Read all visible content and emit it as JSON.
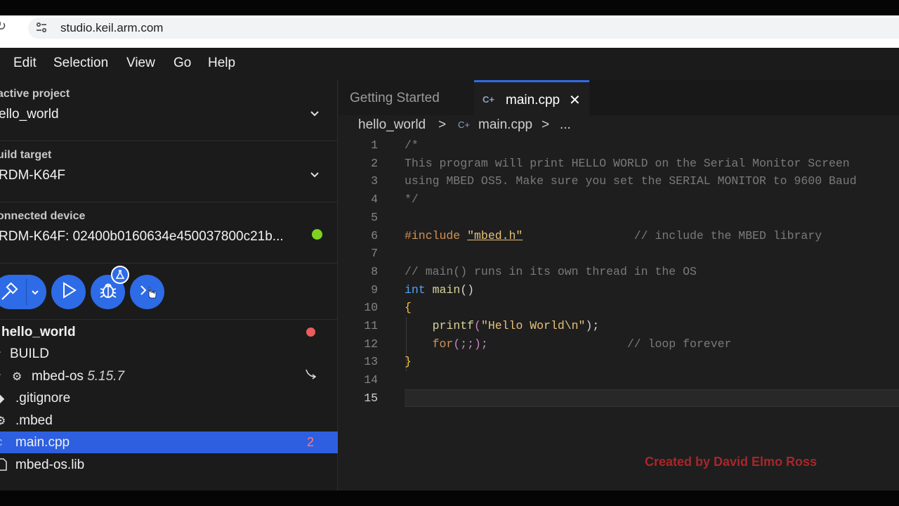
{
  "browser": {
    "url": "studio.keil.arm.com"
  },
  "menu": [
    "Edit",
    "Selection",
    "View",
    "Go",
    "Help"
  ],
  "sidebar": {
    "active_project": {
      "label": "active project",
      "value": "ello_world"
    },
    "build_target": {
      "label": "uild target",
      "value": "RDM-K64F"
    },
    "connected_device": {
      "label": "onnected device",
      "value": "RDM-K64F: 02400b0160634e450037800c21b...",
      "status_color": "#7ed321"
    },
    "actions": [
      "build",
      "run",
      "debug",
      "serial-monitor"
    ],
    "tree": [
      {
        "label": "hello_world",
        "icon": "",
        "badge": "red-dot"
      },
      {
        "label": "BUILD",
        "icon": "chevron-right-icon"
      },
      {
        "label": "mbed-os",
        "version": "5.15.7",
        "icon": "gear-icon",
        "extra": "link-arrow-icon"
      },
      {
        "label": ".gitignore",
        "icon": "git-icon"
      },
      {
        "label": ".mbed",
        "icon": "gear-icon"
      },
      {
        "label": "main.cpp",
        "icon": "cpp-icon",
        "count": "2",
        "selected": true
      },
      {
        "label": "mbed-os.lib",
        "icon": "file-icon"
      }
    ]
  },
  "editor": {
    "tabs": [
      {
        "label": "Getting Started",
        "active": false
      },
      {
        "label": "main.cpp",
        "active": true
      }
    ],
    "breadcrumb": [
      "hello_world",
      ">",
      "main.cpp",
      ">",
      "..."
    ],
    "line_numbers": [
      "1",
      "2",
      "3",
      "4",
      "5",
      "6",
      "7",
      "8",
      "9",
      "10",
      "11",
      "12",
      "13",
      "14",
      "15"
    ],
    "code": {
      "l1": "/*",
      "l2": "This program will print HELLO WORLD on the Serial Monitor Screen",
      "l3": "using MBED OS5. Make sure you set the SERIAL MONITOR to 9600 Baud",
      "l4": "*/",
      "l6_dir": "#include",
      "l6_str": "\"mbed.h\"",
      "l6_com": "// include the MBED library",
      "l8": "// main() runs in its own thread in the OS",
      "l9_kw": "int",
      "l9_fn": "main",
      "l9_paren": "()",
      "l10": "{",
      "l11_fn": "printf",
      "l11_open": "(",
      "l11_str": "\"Hello World\\n\"",
      "l11_close": ");",
      "l12_kw": "for",
      "l12_rest": "(;;);",
      "l12_com": "// loop forever",
      "l13": "}"
    }
  },
  "watermark": "Created by David Elmo Ross",
  "colors": {
    "accent": "#2e6be6",
    "selection": "#2e5fe0",
    "error": "#ec5c5c",
    "online": "#7ed321"
  }
}
